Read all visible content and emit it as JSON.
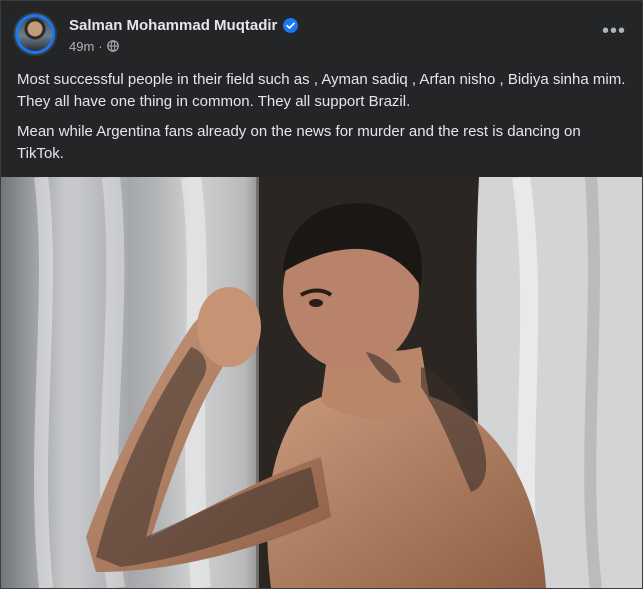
{
  "post": {
    "author": "Salman Mohammad Muqtadir",
    "verified": true,
    "timestamp": "49m",
    "separator": "·",
    "privacy_icon": "globe-icon",
    "more_icon": "more-options-icon",
    "more_label": "•••"
  },
  "caption": {
    "paragraphs": [
      "Most successful people in their field such as , Ayman sadiq , Arfan nisho , Bidiya sinha mim. They all have one thing in common. They all support Brazil.",
      "Mean while Argentina fans already on the news for murder and the rest is dancing on TikTok."
    ]
  },
  "photo": {
    "subject": "shirtless tattooed man posing between white curtains"
  },
  "colors": {
    "background": "#242526",
    "text": "#e4e6eb",
    "secondary_text": "#b0b3b8",
    "verified": "#1877f2"
  }
}
